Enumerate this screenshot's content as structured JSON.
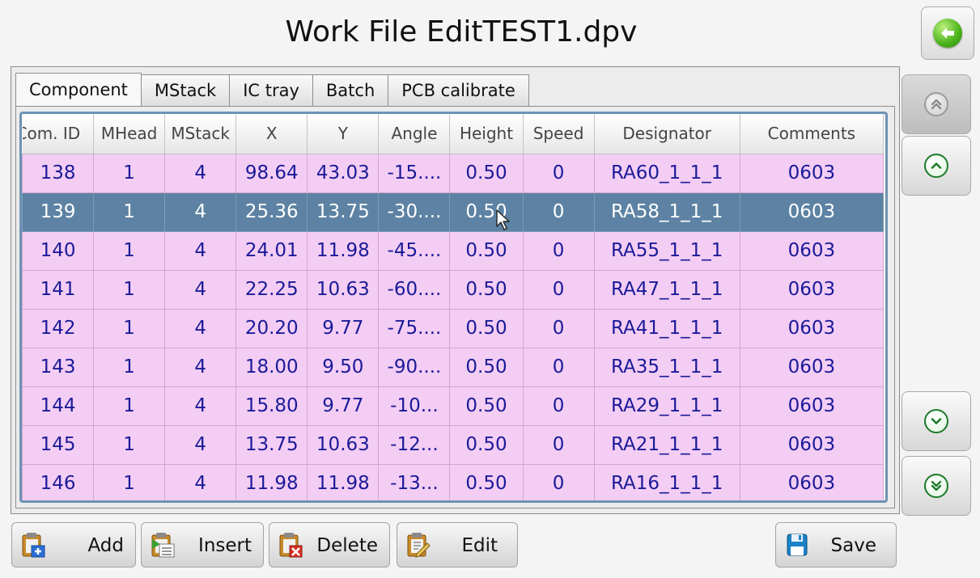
{
  "window": {
    "title": "Work File EditTEST1.dpv"
  },
  "tabs": [
    {
      "label": "Component",
      "active": true
    },
    {
      "label": "MStack",
      "active": false
    },
    {
      "label": "IC tray",
      "active": false
    },
    {
      "label": "Batch",
      "active": false
    },
    {
      "label": "PCB calibrate",
      "active": false
    }
  ],
  "table": {
    "columns": [
      "Com. ID",
      "MHead",
      "MStack",
      "X",
      "Y",
      "Angle",
      "Height",
      "Speed",
      "Designator",
      "Comments"
    ],
    "rows": [
      [
        "138",
        "1",
        "4",
        "98.64",
        "43.03",
        "-15....",
        "0.50",
        "0",
        "RA60_1_1_1",
        "0603"
      ],
      [
        "139",
        "1",
        "4",
        "25.36",
        "13.75",
        "-30....",
        "0.50",
        "0",
        "RA58_1_1_1",
        "0603"
      ],
      [
        "140",
        "1",
        "4",
        "24.01",
        "11.98",
        "-45....",
        "0.50",
        "0",
        "RA55_1_1_1",
        "0603"
      ],
      [
        "141",
        "1",
        "4",
        "22.25",
        "10.63",
        "-60....",
        "0.50",
        "0",
        "RA47_1_1_1",
        "0603"
      ],
      [
        "142",
        "1",
        "4",
        "20.20",
        "9.77",
        "-75....",
        "0.50",
        "0",
        "RA41_1_1_1",
        "0603"
      ],
      [
        "143",
        "1",
        "4",
        "18.00",
        "9.50",
        "-90....",
        "0.50",
        "0",
        "RA35_1_1_1",
        "0603"
      ],
      [
        "144",
        "1",
        "4",
        "15.80",
        "9.77",
        "-10...",
        "0.50",
        "0",
        "RA29_1_1_1",
        "0603"
      ],
      [
        "145",
        "1",
        "4",
        "13.75",
        "10.63",
        "-12...",
        "0.50",
        "0",
        "RA21_1_1_1",
        "0603"
      ],
      [
        "146",
        "1",
        "4",
        "11.98",
        "11.98",
        "-13...",
        "0.50",
        "0",
        "RA16_1_1_1",
        "0603"
      ]
    ],
    "selected_row_index": 1
  },
  "buttons": {
    "add": "Add",
    "insert": "Insert",
    "delete": "Delete",
    "edit": "Edit",
    "save": "Save"
  },
  "side_buttons": [
    {
      "name": "page-up-button",
      "icon": "double-chevron-up-icon",
      "enabled": false
    },
    {
      "name": "row-up-button",
      "icon": "chevron-up-icon",
      "enabled": true
    },
    {
      "name": "row-down-button",
      "icon": "chevron-down-icon",
      "enabled": true
    },
    {
      "name": "page-down-button",
      "icon": "double-chevron-down-icon",
      "enabled": true
    }
  ],
  "colors": {
    "row_background": "#f4cdf4",
    "row_text": "#1a1a98",
    "selected_row_background": "#5d82a3",
    "selected_row_text": "#ffffff",
    "table_border": "#6d93b3"
  }
}
